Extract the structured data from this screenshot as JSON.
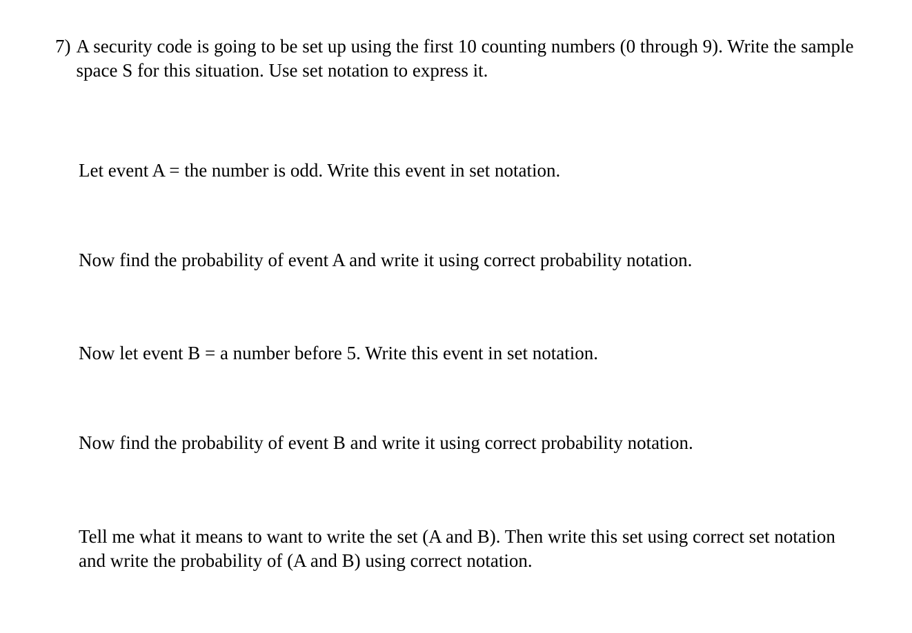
{
  "question": {
    "number": "7)",
    "prompt": "A security code is going to be set up using the first 10 counting numbers (0 through 9). Write the sample space S for this situation.  Use set notation to express it."
  },
  "parts": [
    "Let event A = the number is odd.  Write this event in set notation.",
    "Now find the probability of event A and write it using correct probability notation.",
    "Now let event B = a number before 5.  Write this event in set notation.",
    "Now find the probability of event B and write it using correct probability notation.",
    "Tell me what it means to want to write the set (A and B).  Then write this set using correct set notation and write the probability of (A and B) using correct notation."
  ]
}
